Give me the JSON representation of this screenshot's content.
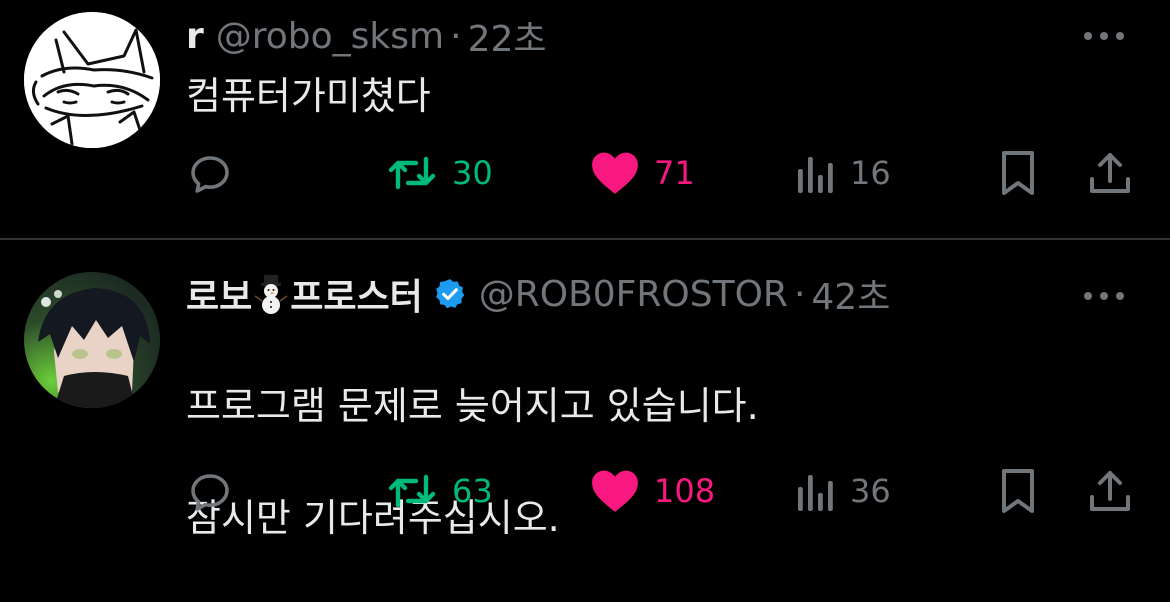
{
  "tweets": [
    {
      "name": "r",
      "handle": "@robo_sksm",
      "separator": "·",
      "time": "22초",
      "text": "컴퓨터가미쳤다",
      "replies": "",
      "retweets": "30",
      "likes": "71",
      "views": "16"
    },
    {
      "name_part1": "로보",
      "name_part2": "프로스터",
      "verified": true,
      "handle": "@ROB0FROSTOR",
      "separator": "·",
      "time": "42초",
      "text_line1": "프로그램 문제로 늦어지고 있습니다.",
      "text_line2": "잠시만 기다려주십시오.",
      "replies": "",
      "retweets": "63",
      "likes": "108",
      "views": "36"
    }
  ],
  "icons": {
    "reply": "reply-icon",
    "retweet": "retweet-icon",
    "like": "heart-icon",
    "views": "views-icon",
    "bookmark": "bookmark-icon",
    "share": "share-icon",
    "more": "more-icon",
    "verified": "verified-badge-icon",
    "snowman": "snowman-emoji"
  },
  "colors": {
    "background": "#000000",
    "text": "#e7e9ea",
    "muted": "#71767b",
    "retweet": "#00ba7c",
    "like": "#f91880",
    "verified": "#1d9bf0",
    "divider": "#2f3336"
  }
}
